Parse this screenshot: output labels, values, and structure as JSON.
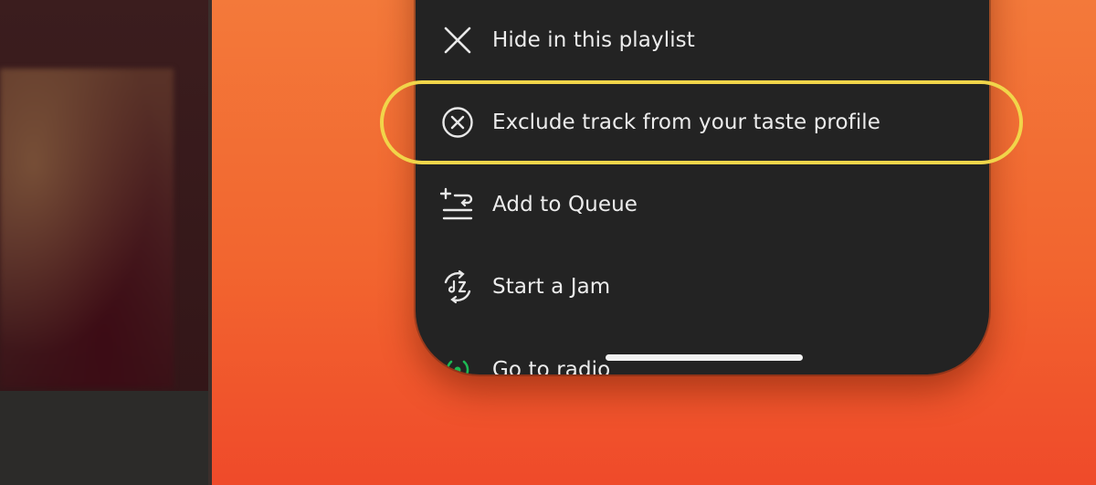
{
  "menu": {
    "items": [
      {
        "label": "Hide in this playlist",
        "icon": "close-x-icon"
      },
      {
        "label": "Exclude track from your taste profile",
        "icon": "circle-x-icon"
      },
      {
        "label": "Add to Queue",
        "icon": "add-to-queue-icon"
      },
      {
        "label": "Start a Jam",
        "icon": "jam-icon"
      },
      {
        "label": "Go to radio",
        "icon": "radio-icon"
      }
    ]
  },
  "colors": {
    "background_top": "#f3793a",
    "background_bottom": "#ef4a2a",
    "sheet": "#232323",
    "text": "#ececec",
    "highlight": "#f1d54a",
    "radio_icon": "#1db954"
  }
}
